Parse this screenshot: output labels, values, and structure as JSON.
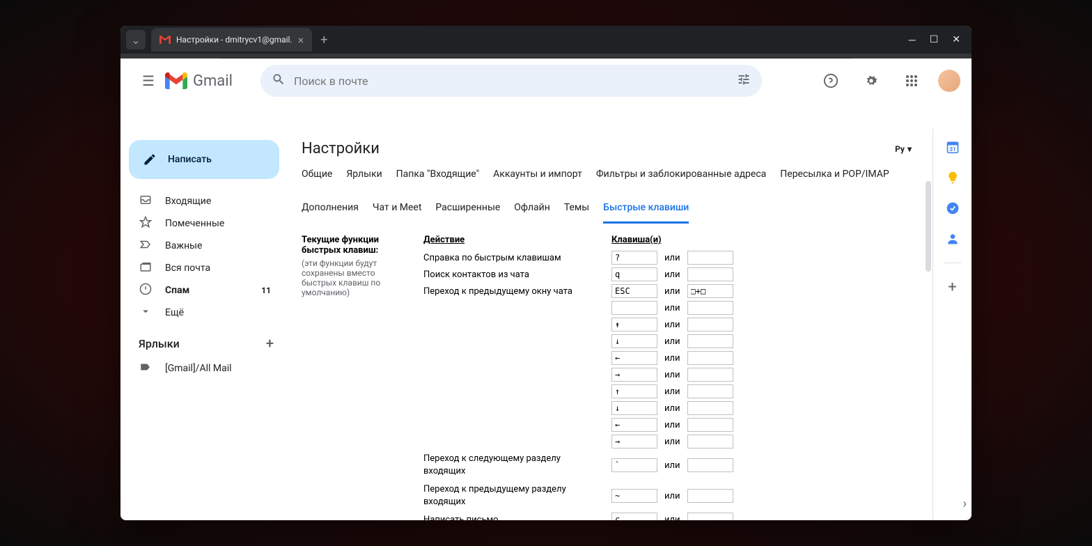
{
  "browser": {
    "tab_title": "Настройки - dmitrycv1@gmail.",
    "url": "mail.google.com/mail/u/0/#settings/shortcuts"
  },
  "header": {
    "logo_text": "Gmail",
    "search_placeholder": "Поиск в почте"
  },
  "sidebar": {
    "compose": "Написать",
    "items": [
      {
        "icon": "inbox",
        "label": "Входящие",
        "bold": false
      },
      {
        "icon": "star",
        "label": "Помеченные",
        "bold": false
      },
      {
        "icon": "important",
        "label": "Важные",
        "bold": false
      },
      {
        "icon": "allmail",
        "label": "Вся почта",
        "bold": false
      },
      {
        "icon": "spam",
        "label": "Спам",
        "bold": true,
        "count": "11"
      },
      {
        "icon": "more",
        "label": "Ещё",
        "bold": false
      }
    ],
    "labels_title": "Ярлыки",
    "labels": [
      {
        "label": "[Gmail]/All Mail"
      }
    ]
  },
  "settings": {
    "title": "Настройки",
    "lang": "Ру",
    "tabs": [
      "Общие",
      "Ярлыки",
      "Папка \"Входящие\"",
      "Аккаунты и импорт",
      "Фильтры и заблокированные адреса",
      "Пересылка и POP/IMAP",
      "Дополнения",
      "Чат и Meet",
      "Расширенные",
      "Офлайн",
      "Темы",
      "Быстрые клавиши"
    ],
    "active_tab_index": 11,
    "left_heading": "Текущие функции быстрых клавиш:",
    "left_sub": "(эти функции будут сохранены вместо быстрых клавиш по умолчанию)",
    "action_header": "Действие",
    "keys_header": "Клавиша(и)",
    "or": "или",
    "shortcuts": [
      {
        "action": "Справка по быстрым клавишам",
        "k1": "?",
        "k2": ""
      },
      {
        "action": "Поиск контактов из чата",
        "k1": "q",
        "k2": ""
      },
      {
        "action": "Переход к предыдущему окну чата",
        "k1": "ESC",
        "k2": "□+□"
      },
      {
        "action": "",
        "k1": "",
        "k2": ""
      },
      {
        "action": "",
        "k1": "↟",
        "k2": ""
      },
      {
        "action": "",
        "k1": "↓",
        "k2": ""
      },
      {
        "action": "",
        "k1": "←",
        "k2": ""
      },
      {
        "action": "",
        "k1": "→",
        "k2": ""
      },
      {
        "action": "",
        "k1": "↑",
        "k2": ""
      },
      {
        "action": "",
        "k1": "↓",
        "k2": ""
      },
      {
        "action": "",
        "k1": "←",
        "k2": ""
      },
      {
        "action": "",
        "k1": "→",
        "k2": ""
      },
      {
        "action": "Переход к следующему разделу входящих",
        "k1": "`",
        "k2": ""
      },
      {
        "action": "Переход к предыдущему разделу входящих",
        "k1": "~",
        "k2": ""
      },
      {
        "action": "Написать письмо",
        "k1": "c",
        "k2": ""
      }
    ]
  }
}
